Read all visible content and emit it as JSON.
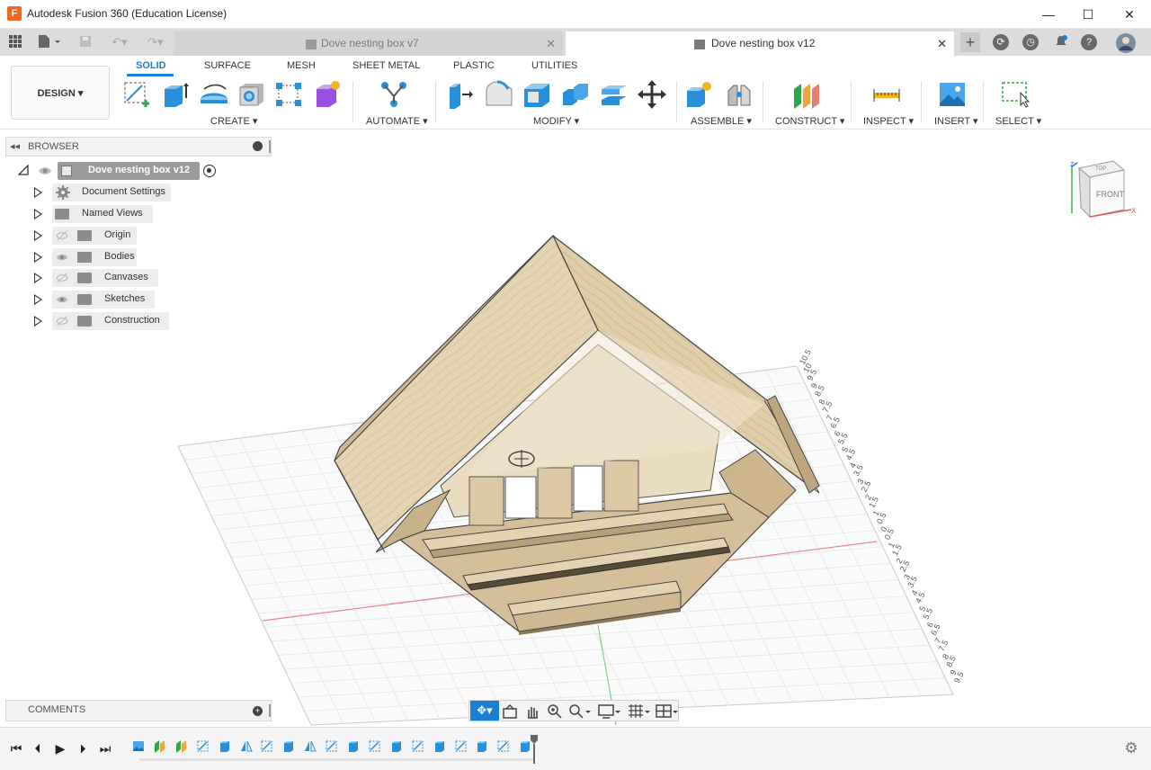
{
  "window": {
    "title": "Autodesk Fusion 360 (Education License)",
    "logo_letter": "F",
    "minimize": "—",
    "maximize": "☐",
    "close": "✕"
  },
  "tabs": [
    {
      "label": "Dove nesting box v7",
      "active": false
    },
    {
      "label": "Dove nesting box v12",
      "active": true
    }
  ],
  "tab_close_glyph": "✕",
  "ribbon": {
    "workspace_button": "DESIGN ▾",
    "tabs": [
      "SOLID",
      "SURFACE",
      "MESH",
      "SHEET METAL",
      "PLASTIC",
      "UTILITIES"
    ],
    "active_tab": "SOLID",
    "groups": [
      "CREATE ▾",
      "AUTOMATE ▾",
      "MODIFY ▾",
      "ASSEMBLE ▾",
      "CONSTRUCT ▾",
      "INSPECT ▾",
      "INSERT ▾",
      "SELECT ▾"
    ]
  },
  "browser": {
    "title": "BROWSER",
    "root_label": "Dove nesting box v12",
    "items": [
      {
        "label": "Document Settings",
        "icon": "gear-icon",
        "eye": "none"
      },
      {
        "label": "Named Views",
        "icon": "folder-icon",
        "eye": "none"
      },
      {
        "label": "Origin",
        "icon": "folder-icon",
        "eye": "hidden"
      },
      {
        "label": "Bodies",
        "icon": "folder-icon",
        "eye": "visible"
      },
      {
        "label": "Canvases",
        "icon": "folder-icon",
        "eye": "hidden"
      },
      {
        "label": "Sketches",
        "icon": "folder-icon",
        "eye": "visible"
      },
      {
        "label": "Construction",
        "icon": "folder-icon",
        "eye": "hidden"
      }
    ]
  },
  "comments": {
    "title": "COMMENTS"
  },
  "viewcube": {
    "top": "TOP",
    "front": "FRONT",
    "x": "X",
    "z": "Z"
  },
  "ruler_labels": [
    "10.5",
    "10",
    "9.5",
    "9",
    "8.5",
    "8",
    "7.5",
    "7",
    "6.5",
    "6",
    "5.5",
    "5",
    "4.5",
    "4",
    "3.5",
    "3",
    "2.5",
    "2",
    "1.5",
    "1",
    "0.5",
    "0",
    "0.5",
    "1",
    "1.5",
    "2",
    "2.5",
    "3",
    "3.5",
    "4",
    "4.5",
    "5",
    "5.5",
    "6",
    "6.5",
    "7",
    "7.5",
    "8",
    "8.5",
    "9",
    "9.5"
  ],
  "colors": {
    "accent": "#1a7fd1",
    "wood_light": "#e6d5b5",
    "wood_mid": "#d6c29d",
    "wood_dark": "#b8a27c",
    "x_axis": "#e8848a",
    "y_axis": "#7fd18a"
  },
  "timeline": {
    "controls": [
      "⏮",
      "⏴",
      "▶",
      "⏵",
      "⏭"
    ],
    "features": [
      "canvas",
      "plane",
      "plane",
      "sketch",
      "extrude",
      "mirror",
      "sketch",
      "extrude",
      "mirror",
      "sketch",
      "extrude",
      "sketch",
      "extrude",
      "sketch",
      "extrude",
      "sketch",
      "extrude",
      "sketch",
      "extrude"
    ]
  }
}
